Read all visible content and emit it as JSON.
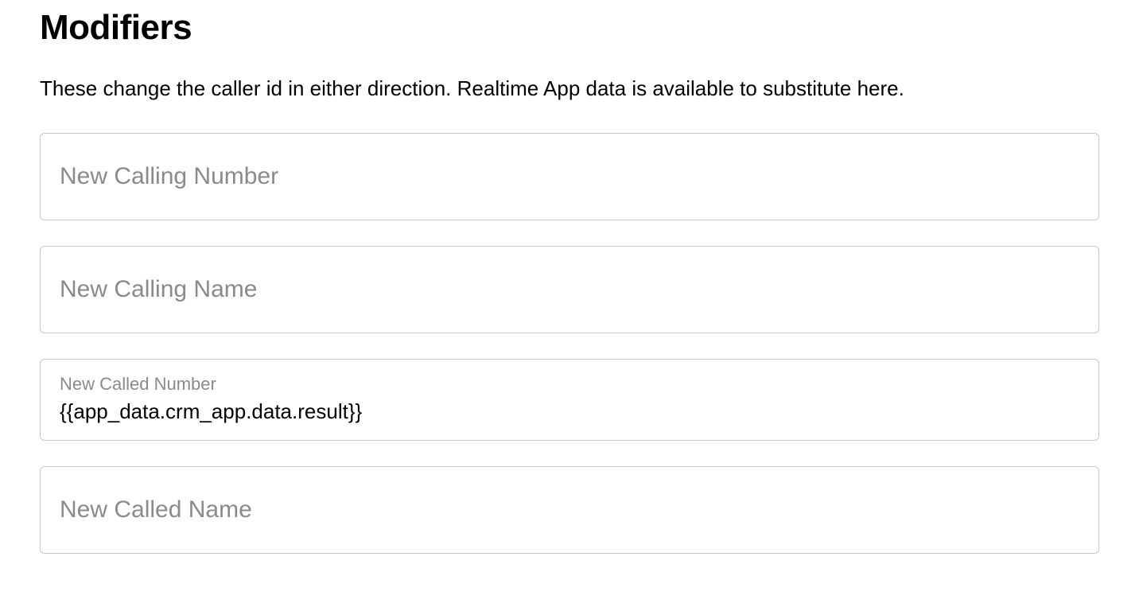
{
  "header": {
    "title": "Modifiers",
    "description": "These change the caller id in either direction. Realtime App data is available to substitute here."
  },
  "fields": {
    "calling_number": {
      "label": "New Calling Number",
      "value": ""
    },
    "calling_name": {
      "label": "New Calling Name",
      "value": ""
    },
    "called_number": {
      "label": "New Called Number",
      "value": "{{app_data.crm_app.data.result}}"
    },
    "called_name": {
      "label": "New Called Name",
      "value": ""
    }
  }
}
